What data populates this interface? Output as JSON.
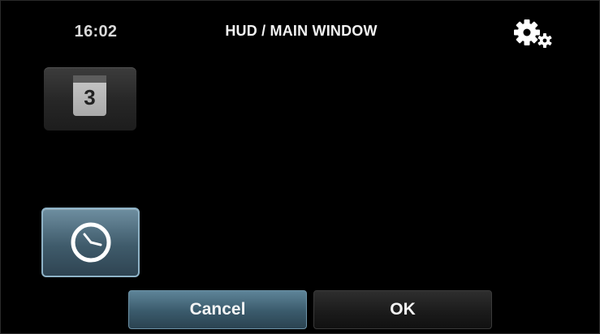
{
  "header": {
    "time": "16:02",
    "title": "HUD / MAIN WINDOW",
    "settings_icon": "gears-icon"
  },
  "tiles": {
    "number_tile": {
      "value": "3"
    },
    "clock_tile": {
      "icon": "clock-icon",
      "selected": true
    }
  },
  "footer": {
    "cancel_label": "Cancel",
    "ok_label": "OK"
  },
  "colors": {
    "background": "#000000",
    "accent_blue": "#4a6b7d",
    "text": "#f2f2f2"
  }
}
